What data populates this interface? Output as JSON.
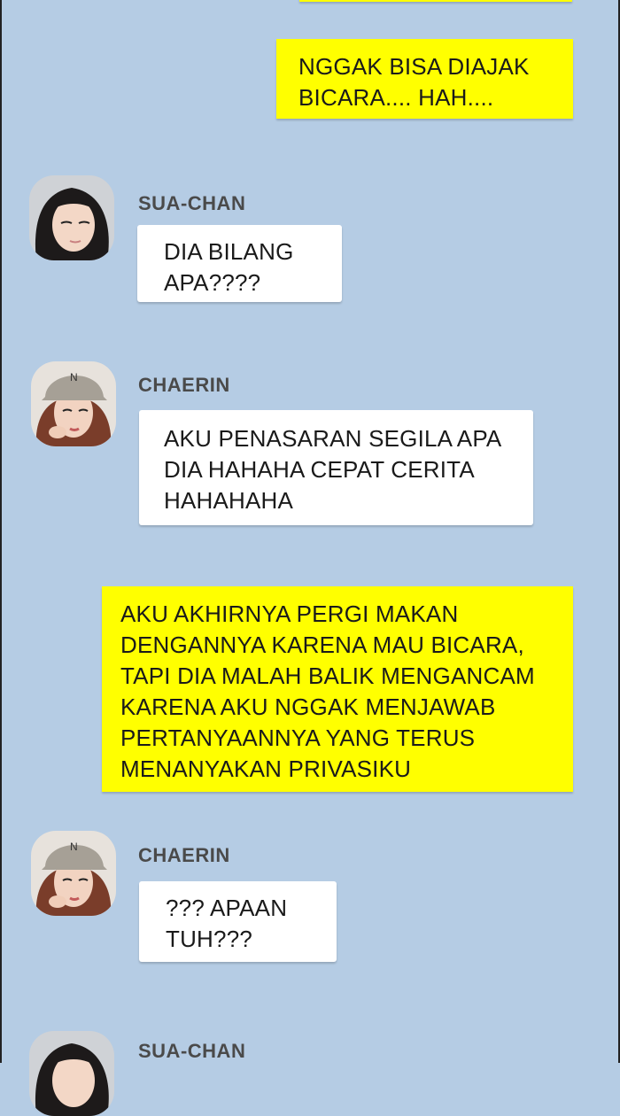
{
  "chat": {
    "messages": [
      {
        "sender": "me",
        "lines": [
          "NGGAK BISA DIAJAK",
          "BICARA.... HAH...."
        ]
      },
      {
        "sender": "SUA-CHAN",
        "lines": [
          "DIA BILANG",
          "APA????"
        ]
      },
      {
        "sender": "CHAERIN",
        "lines": [
          "AKU PENASARAN SEGILA APA",
          "DIA HAHAHA CEPAT CERITA",
          "HAHAHAHA"
        ]
      },
      {
        "sender": "me",
        "lines": [
          "AKU AKHIRNYA PERGI MAKAN",
          "DENGANNYA KARENA MAU BICARA,",
          "TAPI DIA MALAH BALIK MENGANCAM",
          "KARENA AKU NGGAK MENJAWAB",
          "PERTANYAANNYA YANG TERUS",
          "MENANYAKAN PRIVASIKU"
        ]
      },
      {
        "sender": "CHAERIN",
        "lines": [
          "??? APAAN",
          "TUH???"
        ]
      },
      {
        "sender": "SUA-CHAN",
        "lines": []
      }
    ]
  },
  "colors": {
    "background": "#b5cce4",
    "my_bubble": "#ffff00",
    "their_bubble": "#ffffff"
  },
  "icons": {
    "sua_chan_avatar": "woman-black-hair-avatar",
    "chaerin_avatar": "woman-cap-avatar"
  }
}
